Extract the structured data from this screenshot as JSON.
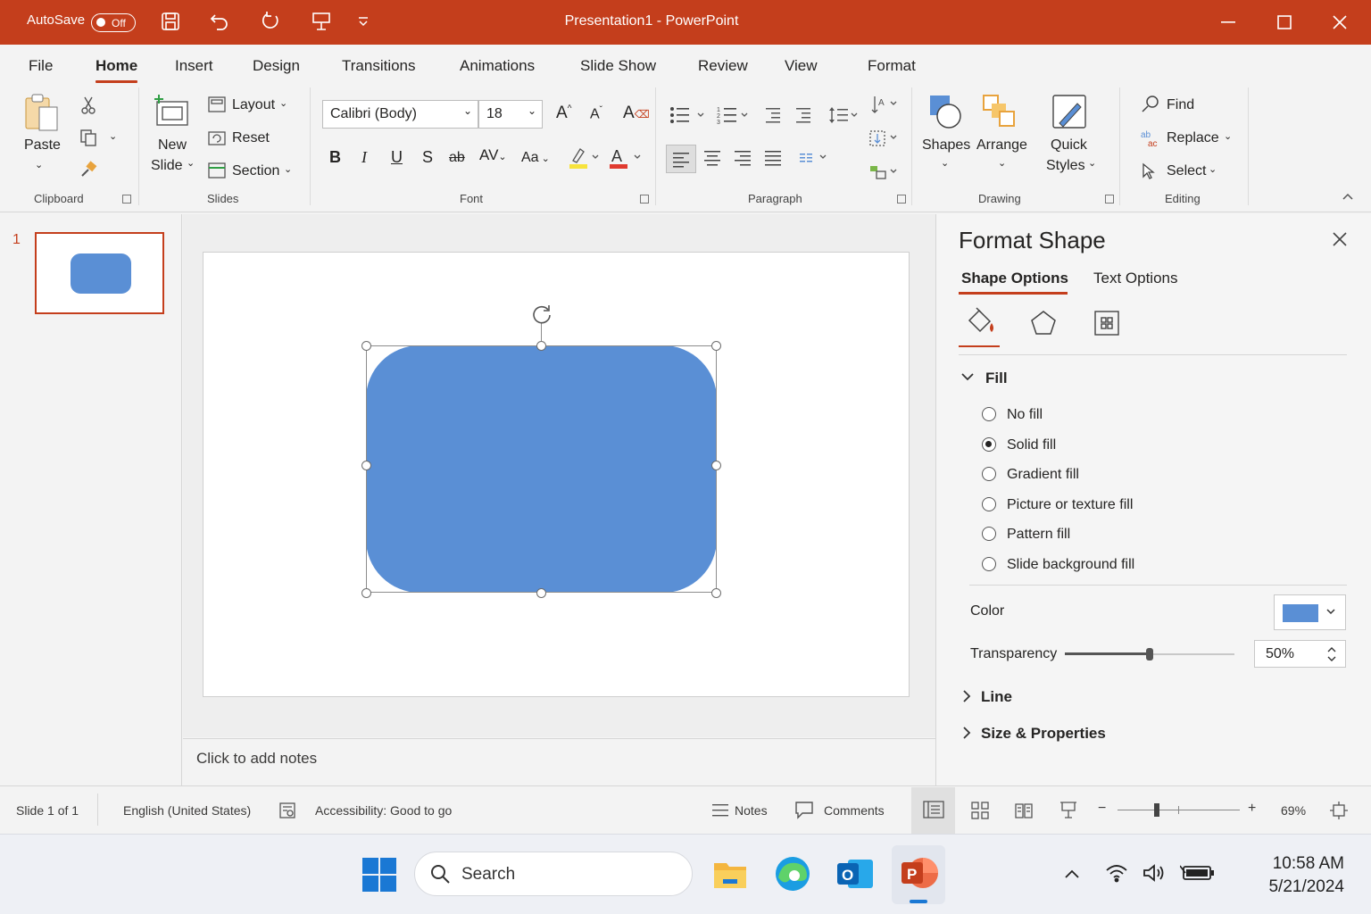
{
  "titlebar": {
    "autosave_label": "AutoSave",
    "autosave_state": "Off",
    "title": "Presentation1  -  PowerPoint"
  },
  "tabs": [
    "File",
    "Home",
    "Insert",
    "Design",
    "Transitions",
    "Animations",
    "Slide Show",
    "Review",
    "View",
    "Format"
  ],
  "active_tab": "Home",
  "ribbon": {
    "clipboard": {
      "paste": "Paste",
      "label": "Clipboard"
    },
    "slides": {
      "new_slide_1": "New",
      "new_slide_2": "Slide",
      "layout": "Layout",
      "reset": "Reset",
      "section": "Section",
      "label": "Slides"
    },
    "font": {
      "font_name": "Calibri (Body)",
      "font_size": "18",
      "label": "Font",
      "aa": "Aa"
    },
    "paragraph": {
      "label": "Paragraph"
    },
    "drawing": {
      "shapes": "Shapes",
      "arrange": "Arrange",
      "quick_1": "Quick",
      "quick_2": "Styles",
      "label": "Drawing"
    },
    "editing": {
      "find": "Find",
      "replace": "Replace",
      "select": "Select",
      "label": "Editing"
    }
  },
  "thumbnails": {
    "slide_number": "1"
  },
  "notes_placeholder": "Click to add notes",
  "format_pane": {
    "title": "Format Shape",
    "tab_shape": "Shape Options",
    "tab_text": "Text Options",
    "fill_header": "Fill",
    "fill_options": [
      "No fill",
      "Solid fill",
      "Gradient fill",
      "Picture or texture fill",
      "Pattern fill",
      "Slide background fill"
    ],
    "selected_fill": "Solid fill",
    "color_label": "Color",
    "color_value": "#5a8fd5",
    "transparency_label": "Transparency",
    "transparency_value": "50%",
    "transparency_fraction": 0.5,
    "line_header": "Line",
    "size_header": "Size & Properties"
  },
  "statusbar": {
    "slide_info": "Slide 1 of 1",
    "language": "English (United States)",
    "accessibility": "Accessibility: Good to go",
    "notes": "Notes",
    "comments": "Comments",
    "zoom": "69%"
  },
  "taskbar": {
    "search": "Search",
    "time": "10:58 AM",
    "date": "5/21/2024"
  },
  "colors": {
    "accent": "#c43e1c",
    "shape": "#5a8fd5"
  }
}
